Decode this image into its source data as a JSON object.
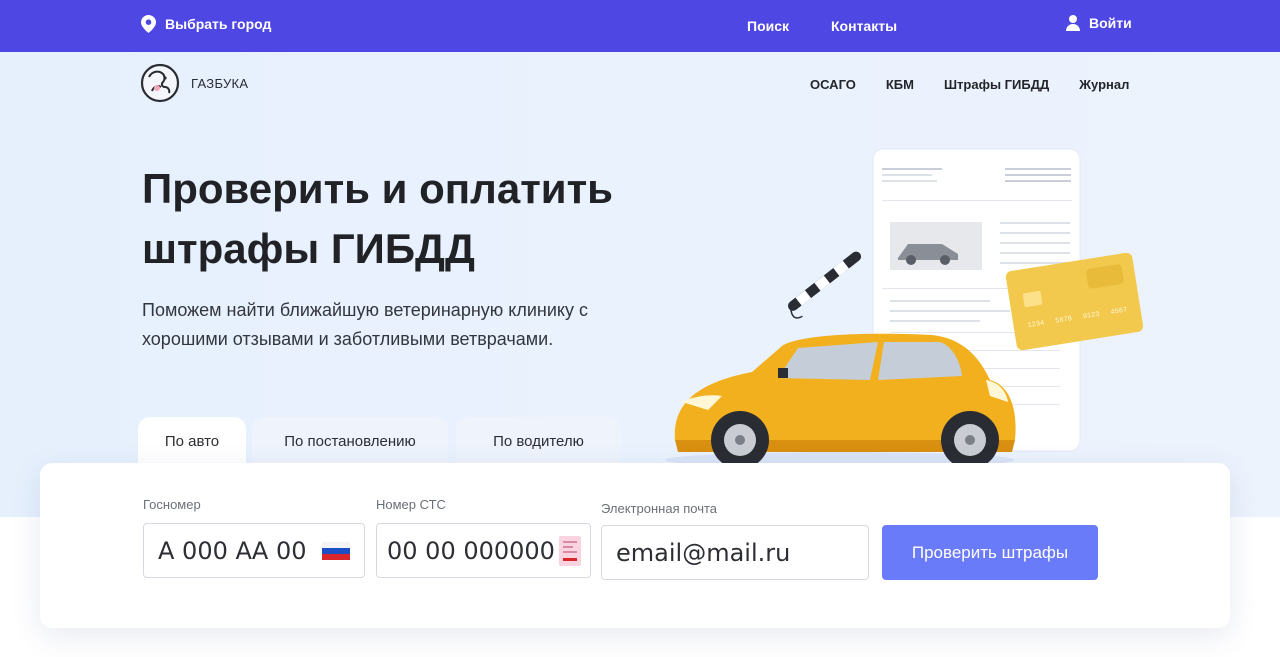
{
  "topbar": {
    "city_label": "Выбрать город",
    "nav": [
      "Поиск",
      "Контакты"
    ],
    "login_label": "Войти",
    "bg_color": "#4f47e4"
  },
  "logo": {
    "text": "ГАЗБУКА"
  },
  "main_nav": [
    "ОСАГО",
    "КБМ",
    "Штрафы ГИБДД",
    "Журнал"
  ],
  "hero": {
    "title_line1": "Проверить и оплатить",
    "title_line2": "штрафы ГИБДД",
    "subtitle_line1": "Поможем найти ближайшую ветеринарную клинику с",
    "subtitle_line2": "хорошими отзывами и заботливыми ветврачами."
  },
  "illustration": {
    "card_number": [
      "1234",
      "5678",
      "9123",
      "4567"
    ],
    "card_color": "#f2c94c",
    "car_color": "#f2b01e"
  },
  "tabs": [
    {
      "label": "По авто",
      "active": true
    },
    {
      "label": "По постановлению",
      "active": false
    },
    {
      "label": "По водителю",
      "active": false
    }
  ],
  "form": {
    "plate_label": "Госномер",
    "plate_placeholder": "А 000 АА 00",
    "sts_label": "Номер СТС",
    "sts_placeholder": "00 00 000000",
    "email_label": "Электронная почта",
    "email_placeholder": "email@mail.ru",
    "submit_label": "Проверить штрафы",
    "accent_color": "#6a7bfa"
  }
}
